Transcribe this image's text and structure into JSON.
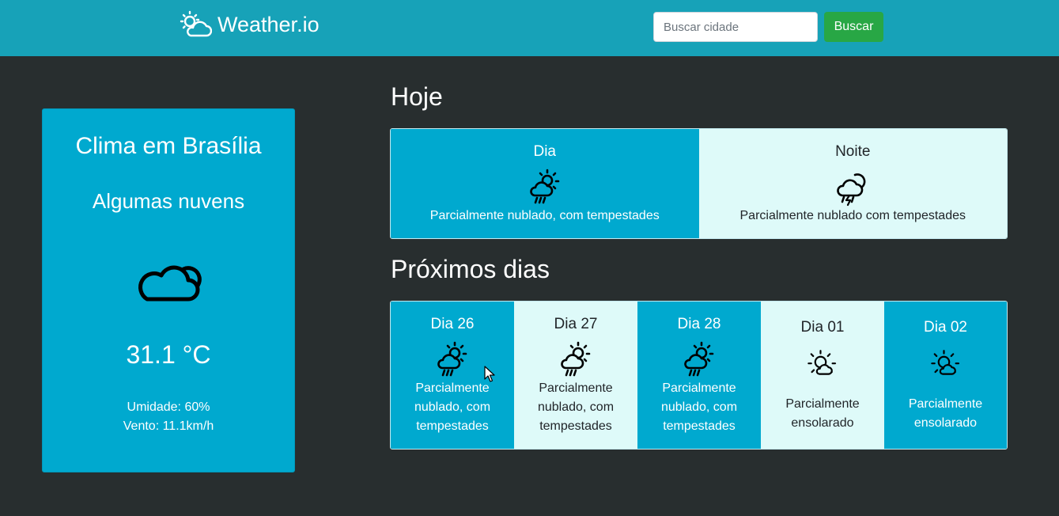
{
  "navbar": {
    "brand_icon": "sun-cloud-icon",
    "brand_name": "Weather.io",
    "search_placeholder": "Buscar cidade",
    "search_button": "Buscar",
    "colors": {
      "navbar": "#17a2b8",
      "button": "#28a745"
    }
  },
  "current": {
    "title": "Clima em Brasília",
    "description": "Algumas nuvens",
    "icon": "cloud-icon",
    "temperature": "31.1 °C",
    "humidity": "Umidade: 60%",
    "wind": "Vento: 11.1km/h"
  },
  "today": {
    "title": "Hoje",
    "day": {
      "label": "Dia",
      "icon": "sun-cloud-rain-icon",
      "description": "Parcialmente nublado, com tempestades"
    },
    "night": {
      "label": "Noite",
      "icon": "cloud-lightning-icon",
      "description": "Parcialmente nublado com tempestades"
    }
  },
  "next": {
    "title": "Próximos dias",
    "days": [
      {
        "label": "Dia 26",
        "icon": "sun-cloud-rain-icon",
        "description": "Parcialmente nublado, com tempestades"
      },
      {
        "label": "Dia 27",
        "icon": "sun-cloud-rain-icon",
        "description": "Parcialmente nublado, com tempestades"
      },
      {
        "label": "Dia 28",
        "icon": "sun-cloud-rain-icon",
        "description": "Parcialmente nublado, com tempestades"
      },
      {
        "label": "Dia 01",
        "icon": "sun-cloud-icon",
        "description": "Parcialmente ensolarado"
      },
      {
        "label": "Dia 02",
        "icon": "sun-cloud-icon",
        "description": "Parcialmente ensolarado"
      }
    ]
  },
  "theme": {
    "background": "#282e2f",
    "card_blue": "#00a9cf",
    "card_light": "#defaf9"
  }
}
